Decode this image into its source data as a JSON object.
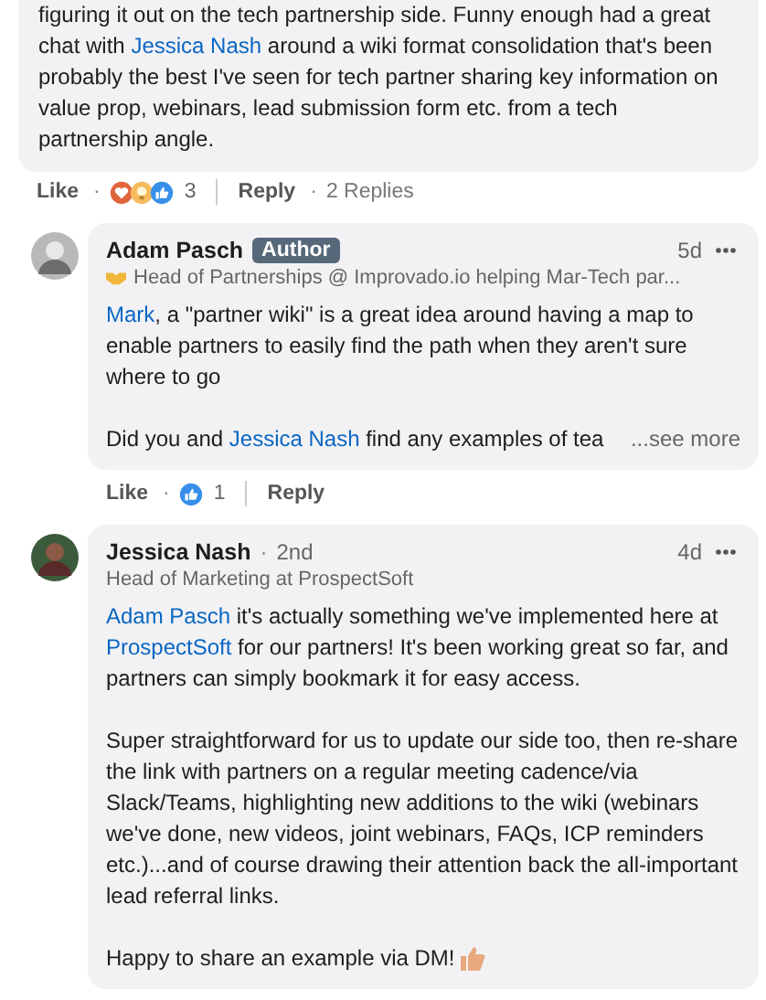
{
  "parent_comment": {
    "paragraphs": [
      [
        {
          "kind": "text",
          "text": "figuring it out on the tech partnership side. Funny enough had a great chat with "
        },
        {
          "kind": "mention",
          "text": "Jessica Nash"
        },
        {
          "kind": "text",
          "text": " around a wiki format consolidation that's been probably the best I've seen for tech partner sharing key information on value prop, webinars, lead submission form etc. from a tech partnership angle."
        }
      ]
    ],
    "actions": {
      "like": "Like",
      "separator": "·",
      "reactions": [
        {
          "kind": "love"
        },
        {
          "kind": "insightful"
        },
        {
          "kind": "like"
        }
      ],
      "reaction_count": "3",
      "reply": "Reply",
      "replies_separator": "·",
      "replies": "2 Replies"
    }
  },
  "replies": [
    {
      "kind": "author",
      "name": "Adam Pasch",
      "badge": "Author",
      "time": "5d",
      "headline": "Head of Partnerships @ Improvado.io helping Mar-Tech par...",
      "paragraphs": [
        [
          {
            "kind": "mention",
            "text": "Mark"
          },
          {
            "kind": "text",
            "text": ", a \"partner wiki\" is a great idea around having a map to enable partners to easily find the path when they aren't sure where to go"
          }
        ],
        [
          {
            "kind": "text",
            "text": "Did you and "
          },
          {
            "kind": "mention",
            "text": "Jessica Nash"
          },
          {
            "kind": "text",
            "text": " find any examples of tea"
          }
        ]
      ],
      "see_more": "...see more",
      "actions": {
        "like": "Like",
        "separator": "·",
        "reactions": [
          {
            "kind": "like"
          }
        ],
        "reaction_count": "1",
        "reply": "Reply"
      }
    },
    {
      "kind": "member",
      "name": "Jessica Nash",
      "separator": "·",
      "degree": "2nd",
      "time": "4d",
      "headline": "Head of Marketing at ProspectSoft",
      "paragraphs": [
        [
          {
            "kind": "mention",
            "text": "Adam Pasch"
          },
          {
            "kind": "text",
            "text": " it's actually something we've implemented here at "
          },
          {
            "kind": "mention",
            "text": "ProspectSoft"
          },
          {
            "kind": "text",
            "text": " for our partners! It's been working great so far, and partners can simply bookmark it for easy access."
          }
        ],
        [
          {
            "kind": "text",
            "text": "Super straightforward for us to update our side too, then re-share the link with partners on a regular meeting cadence/via Slack/Teams, highlighting new additions to the wiki (webinars we've done, new videos, joint webinars, FAQs, ICP reminders etc.)...and of course drawing their attention back the all-important lead referral links."
          }
        ],
        [
          {
            "kind": "text",
            "text": "Happy to share an example via DM! "
          },
          {
            "kind": "emoji"
          }
        ]
      ]
    }
  ]
}
